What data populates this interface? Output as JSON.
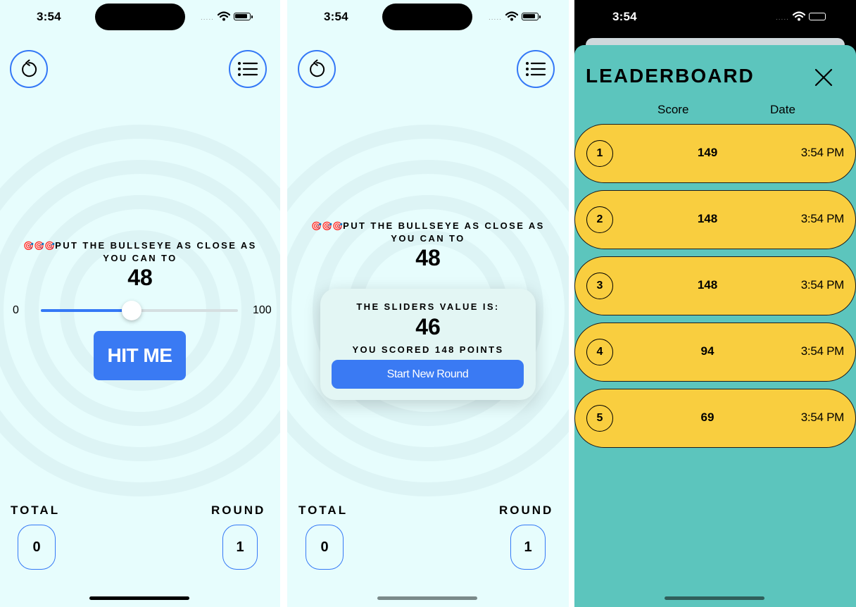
{
  "status_bar": {
    "time": "3:54",
    "dots": "....."
  },
  "game": {
    "instruction_emoji": "🎯🎯🎯",
    "instruction": "PUT THE BULLSEYE AS CLOSE AS YOU CAN TO",
    "target": "48",
    "slider": {
      "min_label": "0",
      "max_label": "100",
      "value": 46
    },
    "hit_button": "HIT ME",
    "total_label": "TOTAL",
    "total_value": "0",
    "round_label": "ROUND",
    "round_value": "1"
  },
  "result": {
    "slider_value_label": "THE SLIDERS VALUE IS:",
    "slider_value": "46",
    "score_text": "YOU SCORED 148 POINTS",
    "new_round_button": "Start New Round"
  },
  "leaderboard": {
    "title": "LEADERBOARD",
    "score_header": "Score",
    "date_header": "Date",
    "rows": [
      {
        "rank": "1",
        "score": "149",
        "time": "3:54 PM"
      },
      {
        "rank": "2",
        "score": "148",
        "time": "3:54 PM"
      },
      {
        "rank": "3",
        "score": "148",
        "time": "3:54 PM"
      },
      {
        "rank": "4",
        "score": "94",
        "time": "3:54 PM"
      },
      {
        "rank": "5",
        "score": "69",
        "time": "3:54 PM"
      }
    ]
  },
  "colors": {
    "accent": "#3478f6",
    "game_bg": "#e7fdfd",
    "leaderboard_bg": "#5cc5bd",
    "row_bg": "#f9ce3f"
  },
  "icons": [
    "restart-icon",
    "list-icon",
    "close-icon",
    "wifi-icon",
    "battery-icon"
  ]
}
